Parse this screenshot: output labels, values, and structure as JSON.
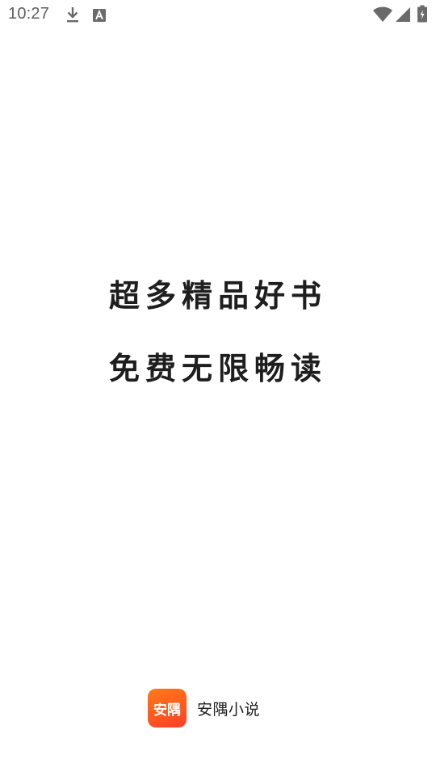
{
  "status_bar": {
    "time": "10:27",
    "icons": [
      "download-icon",
      "a-text-icon",
      "wifi-icon",
      "cellular-signal-icon",
      "battery-charging-icon"
    ]
  },
  "splash": {
    "slogan_line_1": "超多精品好书",
    "slogan_line_2": "免费无限畅读"
  },
  "brand": {
    "logo_text": "安隅",
    "app_name": "安隅小说",
    "accent_color": "#ff5b1f"
  }
}
